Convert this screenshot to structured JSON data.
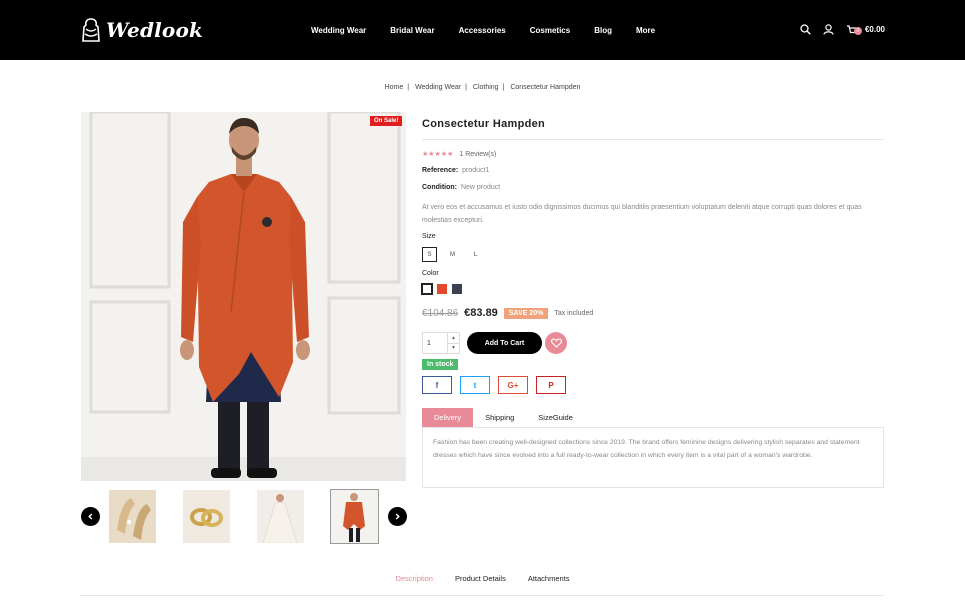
{
  "brand": {
    "name": "Wedlook"
  },
  "nav": {
    "items": [
      "Wedding Wear",
      "Bridal Wear",
      "Accessories",
      "Cosmetics",
      "Blog",
      "More"
    ]
  },
  "header": {
    "cart_count": "0",
    "cart_total": "€0.00",
    "icons": [
      "search-icon",
      "user-icon",
      "cart-icon"
    ]
  },
  "breadcrumb": [
    "Home",
    "Wedding Wear",
    "Clothing",
    "Consectetur Hampden"
  ],
  "product": {
    "badge": "On Sale!",
    "title": "Consectetur Hampden",
    "reviews": "1 Review(s)",
    "reference_label": "Reference:",
    "reference_value": "product1",
    "condition_label": "Condition:",
    "condition_value": "New product",
    "description": "At vero eos et accusamus et iusto odio dignissimos ducimus qui blanditiis praesentium voluptatum deleniti atque corrupti quas dolores et quas molestias excepturi.",
    "size_label": "Size",
    "sizes": [
      "S",
      "M",
      "L"
    ],
    "color_label": "Color",
    "colors": [
      "#ffffff",
      "#e3482d",
      "#3b4150"
    ],
    "old_price": "€104.86",
    "price": "€83.89",
    "save": "SAVE 20%",
    "tax": "Tax included",
    "quantity": "1",
    "add_to_cart": "Add To Cart",
    "stock": "In stock"
  },
  "share": [
    {
      "icon": "facebook-icon",
      "glyph": "f",
      "color": "#3b5998"
    },
    {
      "icon": "twitter-icon",
      "glyph": "t",
      "color": "#1da1f2"
    },
    {
      "icon": "google-plus-icon",
      "glyph": "G+",
      "color": "#dd4b39"
    },
    {
      "icon": "pinterest-icon",
      "glyph": "P",
      "color": "#cb2027"
    }
  ],
  "info_tabs": [
    "Delivery",
    "Shipping",
    "SizeGuide"
  ],
  "info_text": "Fashion has been creating well-designed collections since 2019. The brand offers feminine designs delivering stylish separates and statement dresses which have since evolved into a full ready-to-wear collection in which every item is a vital part of a woman's wardrobe.",
  "bottom_tabs": [
    "Description",
    "Product Details",
    "Attachments"
  ],
  "accent_color": "#e88a97"
}
